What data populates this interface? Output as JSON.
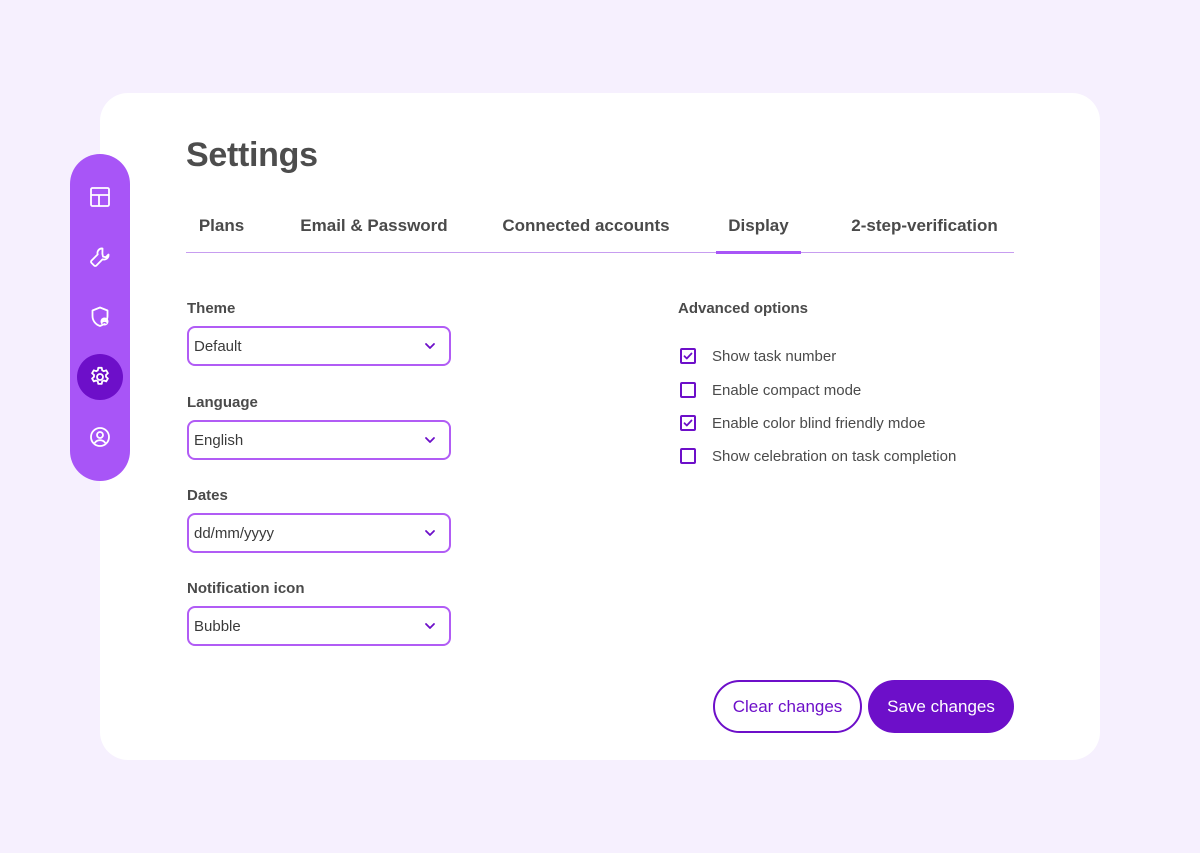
{
  "page": {
    "title": "Settings"
  },
  "sidebar": {
    "items": [
      {
        "icon": "layout-icon"
      },
      {
        "icon": "wrench-icon"
      },
      {
        "icon": "shield-user-icon"
      },
      {
        "icon": "gear-icon",
        "active": true
      },
      {
        "icon": "user-circle-icon"
      }
    ]
  },
  "tabs": [
    {
      "label": "Plans"
    },
    {
      "label": "Email & Password"
    },
    {
      "label": "Connected accounts"
    },
    {
      "label": "Display",
      "active": true
    },
    {
      "label": "2-step-verification"
    }
  ],
  "display": {
    "theme": {
      "label": "Theme",
      "value": "Default"
    },
    "language": {
      "label": "Language",
      "value": "English"
    },
    "dates": {
      "label": "Dates",
      "value": "dd/mm/yyyy"
    },
    "notification_icon": {
      "label": "Notification icon",
      "value": "Bubble"
    }
  },
  "advanced": {
    "title": "Advanced options",
    "options": [
      {
        "label": "Show task number",
        "checked": true
      },
      {
        "label": "Enable compact mode",
        "checked": false
      },
      {
        "label": "Enable color blind friendly mdoe",
        "checked": true
      },
      {
        "label": "Show celebration on task completion",
        "checked": false
      }
    ]
  },
  "actions": {
    "clear_label": "Clear changes",
    "save_label": "Save changes"
  },
  "colors": {
    "background": "#f6f0fe",
    "sidebar": "#a855f7",
    "primary": "#6d0fc9",
    "select_border": "#b15cf5"
  }
}
